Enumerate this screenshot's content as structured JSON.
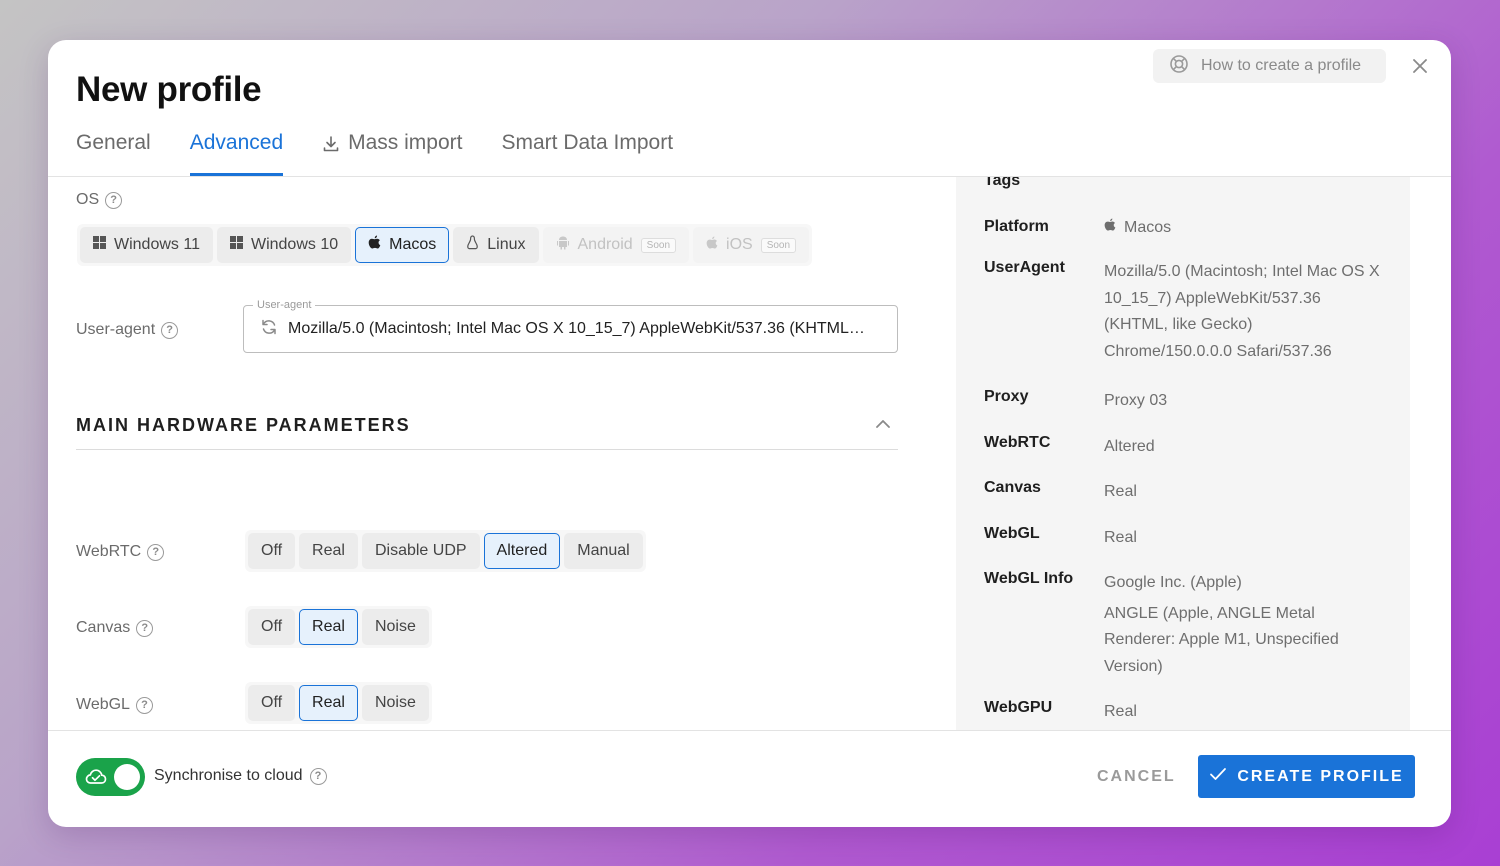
{
  "header": {
    "title": "New profile",
    "help_label": "How to create a profile"
  },
  "tabs": [
    {
      "label": "General",
      "active": false
    },
    {
      "label": "Advanced",
      "active": true
    },
    {
      "label": "Mass import",
      "active": false
    },
    {
      "label": "Smart Data Import",
      "active": false
    }
  ],
  "os": {
    "label": "OS",
    "options": [
      {
        "label": "Windows 11",
        "icon": "windows-icon",
        "selected": false,
        "disabled": false
      },
      {
        "label": "Windows 10",
        "icon": "windows-icon",
        "selected": false,
        "disabled": false
      },
      {
        "label": "Macos",
        "icon": "apple-icon",
        "selected": true,
        "disabled": false
      },
      {
        "label": "Linux",
        "icon": "linux-icon",
        "selected": false,
        "disabled": false
      },
      {
        "label": "Android",
        "icon": "android-icon",
        "selected": false,
        "disabled": true,
        "badge": "Soon"
      },
      {
        "label": "iOS",
        "icon": "apple-icon",
        "selected": false,
        "disabled": true,
        "badge": "Soon"
      }
    ]
  },
  "user_agent": {
    "label": "User-agent",
    "legend": "User-agent",
    "value": "Mozilla/5.0 (Macintosh; Intel Mac OS X 10_15_7) AppleWebKit/537.36 (KHTML…"
  },
  "hardware": {
    "section_title": "MAIN HARDWARE PARAMETERS",
    "webrtc": {
      "label": "WebRTC",
      "options": [
        "Off",
        "Real",
        "Disable UDP",
        "Altered",
        "Manual"
      ],
      "selected": "Altered"
    },
    "canvas": {
      "label": "Canvas",
      "options": [
        "Off",
        "Real",
        "Noise"
      ],
      "selected": "Real"
    },
    "webgl": {
      "label": "WebGL",
      "options": [
        "Off",
        "Real",
        "Noise"
      ],
      "selected": "Real"
    }
  },
  "summary": {
    "tags_label": "Tags",
    "platform": {
      "key": "Platform",
      "value": "Macos"
    },
    "useragent": {
      "key": "UserAgent",
      "value": "Mozilla/5.0 (Macintosh; Intel Mac OS X 10_15_7) AppleWebKit/537.36 (KHTML, like Gecko) Chrome/150.0.0.0 Safari/537.36"
    },
    "proxy": {
      "key": "Proxy",
      "value": "Proxy 03"
    },
    "webrtc": {
      "key": "WebRTC",
      "value": "Altered"
    },
    "canvas": {
      "key": "Canvas",
      "value": "Real"
    },
    "webgl": {
      "key": "WebGL",
      "value": "Real"
    },
    "webgl_info": {
      "key": "WebGL Info",
      "vendor": "Google Inc. (Apple)",
      "renderer": "ANGLE (Apple, ANGLE Metal Renderer: Apple M1, Unspecified Version)"
    },
    "webgpu": {
      "key": "WebGPU",
      "value": "Real"
    }
  },
  "footer": {
    "sync_label": "Synchronise to cloud",
    "sync_on": true,
    "cancel_label": "CANCEL",
    "create_label": "CREATE PROFILE"
  },
  "colors": {
    "accent": "#1a73d8",
    "toggle_on": "#1aa34a"
  }
}
